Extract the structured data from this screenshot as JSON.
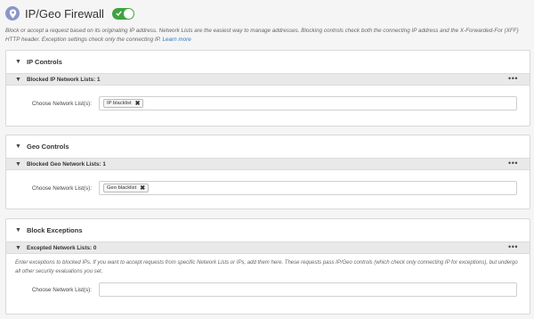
{
  "header": {
    "title": "IP/Geo Firewall",
    "icon": "location-pin-icon",
    "enabled": true
  },
  "description": {
    "text": "Block or accept a request based on its originating IP address. Network Lists are the easiest way to manage addresses. Blocking controls check both the connecting IP address and the X-Forwarded-For (XFF) HTTP header. Exception settings check only the connecting IP.",
    "link": "Learn more"
  },
  "ip_controls": {
    "title": "IP Controls",
    "sub_title": "Blocked IP Network Lists: 1",
    "field_label": "Choose Network List(s):",
    "tags": [
      "IP blacklist"
    ]
  },
  "geo_controls": {
    "title": "Geo Controls",
    "sub_title": "Blocked Geo Network Lists: 1",
    "field_label": "Choose Network List(s):",
    "tags": [
      "Geo blacklist"
    ]
  },
  "block_exceptions": {
    "title": "Block Exceptions",
    "sub_title": "Excepted Network Lists: 0",
    "help_text": "Enter exceptions to blocked IPs. If you want to accept requests from specific Network Lists or IPs, add them here. These requests pass IP/Geo controls (which check only connecting IP for exceptions), but undergo all other security evaluations you set.",
    "field_label": "Choose Network List(s):",
    "tags": []
  },
  "colors": {
    "toggle_on": "#3fa33f",
    "icon_bg": "#8a96c9",
    "link": "#2a78c8"
  }
}
